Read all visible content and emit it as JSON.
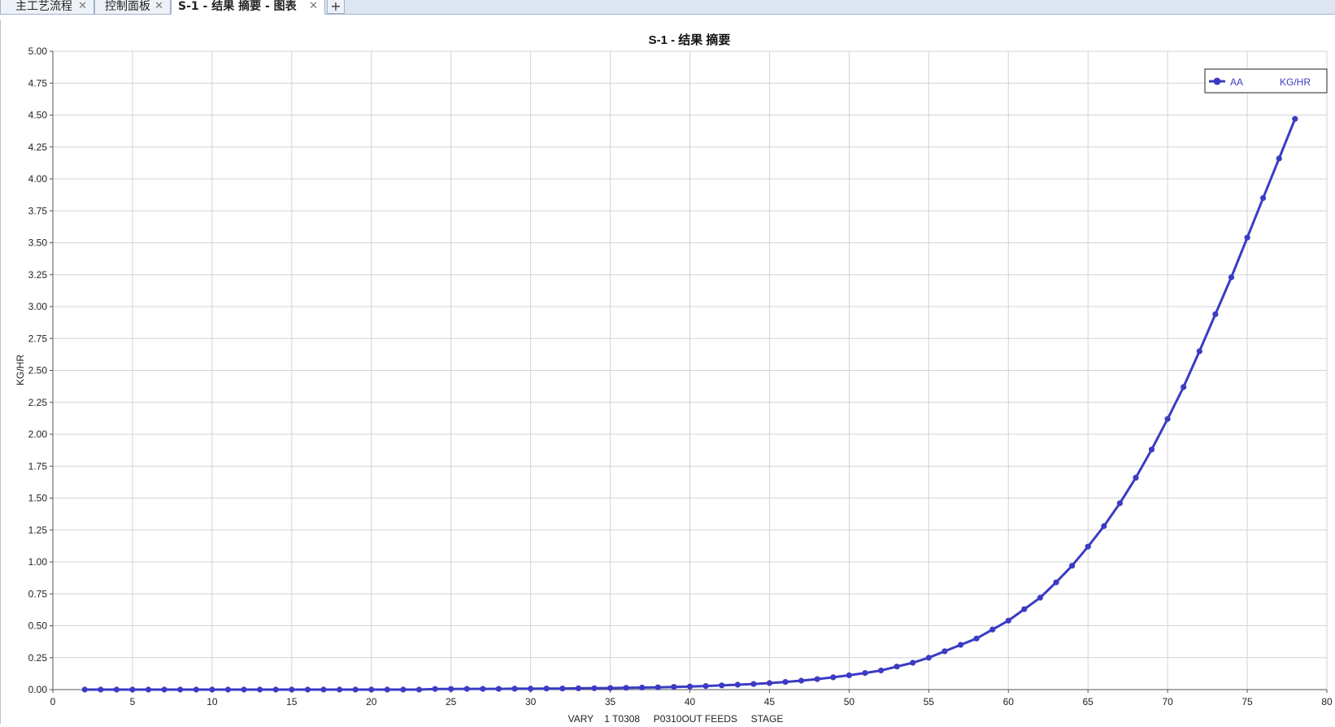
{
  "tabs": [
    {
      "label": "主工艺流程",
      "close": "✕",
      "active": false
    },
    {
      "label": "控制面板",
      "close": "✕",
      "active": false
    },
    {
      "label": "S-1 - 结果 摘要 - 图表",
      "close": "✕",
      "active": true
    }
  ],
  "add_tab": "+",
  "chart_data": {
    "type": "line",
    "title": "S-1 - 结果 摘要",
    "xlabel": "VARY    1 T0308     P0310OUT FEEDS     STAGE",
    "ylabel": "KG/HR",
    "xlim": [
      0,
      80
    ],
    "ylim": [
      0,
      5
    ],
    "x_ticks": [
      "0",
      "5",
      "10",
      "15",
      "20",
      "25",
      "30",
      "35",
      "40",
      "45",
      "50",
      "55",
      "60",
      "65",
      "70",
      "75",
      "80"
    ],
    "y_ticks": [
      "0.00",
      "0.25",
      "0.50",
      "0.75",
      "1.00",
      "1.25",
      "1.50",
      "1.75",
      "2.00",
      "2.25",
      "2.50",
      "2.75",
      "3.00",
      "3.25",
      "3.50",
      "3.75",
      "4.00",
      "4.25",
      "4.50",
      "4.75",
      "5.00"
    ],
    "grid": true,
    "legend_position": "top-right",
    "series": [
      {
        "name": "AA",
        "unit": "KG/HR",
        "color": "#3b3bc4",
        "x": [
          2,
          3,
          4,
          5,
          6,
          7,
          8,
          9,
          10,
          11,
          12,
          13,
          14,
          15,
          16,
          17,
          18,
          19,
          20,
          21,
          22,
          23,
          24,
          25,
          26,
          27,
          28,
          29,
          30,
          31,
          32,
          33,
          34,
          35,
          36,
          37,
          38,
          39,
          40,
          41,
          42,
          43,
          44,
          45,
          46,
          47,
          48,
          49,
          50,
          51,
          52,
          53,
          54,
          55,
          56,
          57,
          58,
          59,
          60,
          61,
          62,
          63,
          64,
          65,
          66,
          67,
          68,
          69,
          70,
          71,
          72,
          73,
          74,
          75,
          76,
          77,
          78
        ],
        "y": [
          0.0,
          0.0,
          0.0,
          0.0,
          0.0,
          0.0,
          0.0,
          0.0,
          0.0,
          0.0,
          0.0,
          0.0,
          0.0,
          0.0,
          0.0,
          0.0,
          0.0,
          0.0,
          0.0,
          0.0,
          0.0,
          0.0,
          0.005,
          0.005,
          0.006,
          0.006,
          0.006,
          0.007,
          0.007,
          0.008,
          0.008,
          0.01,
          0.011,
          0.012,
          0.014,
          0.016,
          0.018,
          0.021,
          0.024,
          0.028,
          0.033,
          0.038,
          0.044,
          0.051,
          0.06,
          0.07,
          0.082,
          0.096,
          0.112,
          0.13,
          0.15,
          0.18,
          0.21,
          0.25,
          0.3,
          0.35,
          0.4,
          0.47,
          0.54,
          0.63,
          0.72,
          0.84,
          0.97,
          1.12,
          1.28,
          1.46,
          1.66,
          1.88,
          2.12,
          2.37,
          2.65,
          2.94,
          3.23,
          3.54,
          3.85,
          4.16,
          4.47
        ]
      }
    ]
  }
}
